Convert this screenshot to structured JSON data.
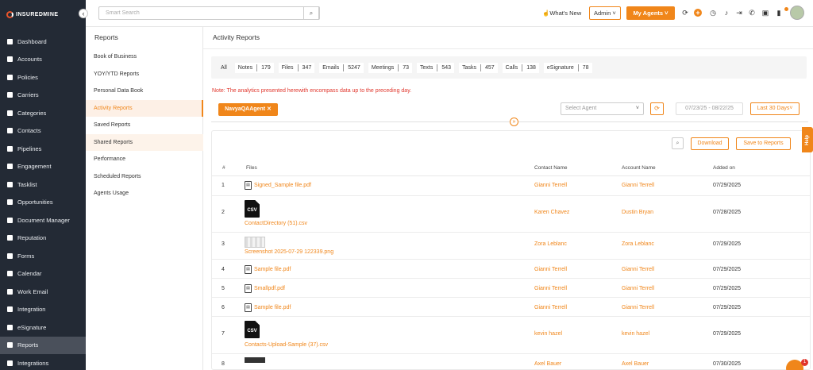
{
  "app": {
    "logo_text": "INSUREDMINE"
  },
  "sidebar": {
    "items": [
      {
        "label": "Dashboard",
        "active": false
      },
      {
        "label": "Accounts",
        "active": false
      },
      {
        "label": "Policies",
        "active": false
      },
      {
        "label": "Carriers",
        "active": false
      },
      {
        "label": "Categories",
        "active": false
      },
      {
        "label": "Contacts",
        "active": false
      },
      {
        "label": "Pipelines",
        "active": false
      },
      {
        "label": "Engagement",
        "active": false
      },
      {
        "label": "Tasklist",
        "active": false
      },
      {
        "label": "Opportunities",
        "active": false
      },
      {
        "label": "Document Manager",
        "active": false
      },
      {
        "label": "Reputation",
        "active": false
      },
      {
        "label": "Forms",
        "active": false
      },
      {
        "label": "Calendar",
        "active": false
      },
      {
        "label": "Work Email",
        "active": false
      },
      {
        "label": "Integration",
        "active": false
      },
      {
        "label": "eSignature",
        "active": false
      },
      {
        "label": "Reports",
        "active": true
      },
      {
        "label": "Integrations",
        "active": false
      }
    ]
  },
  "topbar": {
    "search_placeholder": "Smart Search",
    "whats_new": "What's New",
    "admin_label": "Admin",
    "my_agents_label": "My Agents",
    "accent": "#f0861a"
  },
  "subnav": {
    "title": "Reports",
    "items": [
      "Book of Business",
      "YOY/YTD Reports",
      "Personal Data Book",
      "Activity Reports",
      "Saved Reports",
      "Shared Reports",
      "Performance",
      "Scheduled Reports",
      "Agents Usage"
    ]
  },
  "main": {
    "title": "Activity Reports",
    "tabs": [
      {
        "label": "All",
        "count": ""
      },
      {
        "label": "Notes",
        "count": "179"
      },
      {
        "label": "Files",
        "count": "347"
      },
      {
        "label": "Emails",
        "count": "5247"
      },
      {
        "label": "Meetings",
        "count": "73"
      },
      {
        "label": "Texts",
        "count": "543"
      },
      {
        "label": "Tasks",
        "count": "457"
      },
      {
        "label": "Calls",
        "count": "138"
      },
      {
        "label": "eSignature",
        "count": "78"
      }
    ],
    "note": "Note: The analytics presented herewith encompass data up to the preceding day.",
    "agent_chip": "NavyaQAAgent",
    "select_agent_placeholder": "Select Agent",
    "date_range": "07/23/25 - 08/22/25",
    "range_label": "Last 30 Days",
    "download_label": "Download",
    "save_label": "Save to Reports"
  },
  "table": {
    "headers": {
      "num": "#",
      "files": "Files",
      "contact": "Contact Name",
      "account": "Account Name",
      "added": "Added on"
    },
    "rows": [
      {
        "num": "1",
        "file": "Signed_Sample file.pdf",
        "type": "pdf",
        "contact": "Gianni Terrell",
        "account": "Gianni Terrell",
        "added": "07/29/2025"
      },
      {
        "num": "2",
        "file": "ContactDirectory (51).csv",
        "type": "csv",
        "contact": "Karen Chavez",
        "account": "Dustin Bryan",
        "added": "07/28/2025"
      },
      {
        "num": "3",
        "file": "Screenshot 2025-07-29 122339.png",
        "type": "png",
        "contact": "Zora Leblanc",
        "account": "Zora Leblanc",
        "added": "07/29/2025"
      },
      {
        "num": "4",
        "file": "Sample file.pdf",
        "type": "pdf",
        "contact": "Gianni Terrell",
        "account": "Gianni Terrell",
        "added": "07/29/2025"
      },
      {
        "num": "5",
        "file": "Smallpdf.pdf",
        "type": "pdf",
        "contact": "Gianni Terrell",
        "account": "Gianni Terrell",
        "added": "07/29/2025"
      },
      {
        "num": "6",
        "file": "Sample file.pdf",
        "type": "pdf",
        "contact": "Gianni Terrell",
        "account": "Gianni Terrell",
        "added": "07/29/2025"
      },
      {
        "num": "7",
        "file": "Contacts-Upload-Sample (37).csv",
        "type": "csv",
        "contact": "kevin hazel",
        "account": "kevin hazel",
        "added": "07/29/2025"
      },
      {
        "num": "8",
        "file": "",
        "type": "img",
        "contact": "Axel Bauer",
        "account": "Axel Bauer",
        "added": "07/30/2025"
      }
    ]
  },
  "help_label": "Help",
  "chat_badge": "1"
}
